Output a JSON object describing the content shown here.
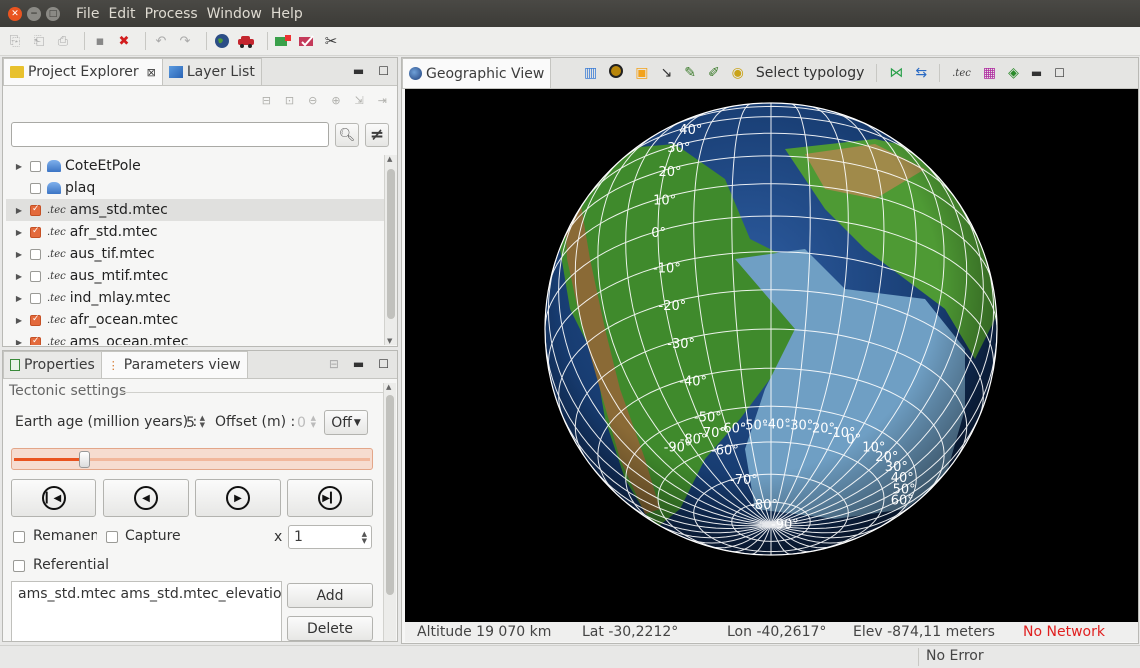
{
  "window": {
    "menu": [
      "File",
      "Edit",
      "Process",
      "Window",
      "Help"
    ]
  },
  "left_top": {
    "tabs": [
      {
        "label": "Project Explorer"
      },
      {
        "label": "Layer List"
      }
    ],
    "search_value": "",
    "tree": [
      {
        "label": "CoteEtPole",
        "checked": false,
        "icon": "cloud-layer-icon",
        "expand": true
      },
      {
        "label": "plaq",
        "checked": false,
        "icon": "cloud-layer-icon",
        "expand": false
      },
      {
        "label": "ams_std.mtec",
        "checked": true,
        "icon": "tec-file-icon",
        "expand": true,
        "selected": true
      },
      {
        "label": "afr_std.mtec",
        "checked": true,
        "icon": "tec-file-icon",
        "expand": true
      },
      {
        "label": "aus_tif.mtec",
        "checked": false,
        "icon": "tec-file-icon",
        "expand": true
      },
      {
        "label": "aus_mtif.mtec",
        "checked": false,
        "icon": "tec-file-icon",
        "expand": true
      },
      {
        "label": "ind_mlay.mtec",
        "checked": false,
        "icon": "tec-file-icon",
        "expand": true
      },
      {
        "label": "afr_ocean.mtec",
        "checked": true,
        "icon": "tec-file-icon",
        "expand": true
      },
      {
        "label": "ams_ocean.mtec",
        "checked": true,
        "icon": "tec-file-icon",
        "expand": true
      }
    ],
    "tec_icon_text": ".tec"
  },
  "left_bottom": {
    "tabs": [
      {
        "label": "Properties"
      },
      {
        "label": "Parameters view"
      }
    ],
    "group_title": "Tectonic settings",
    "earth_age_label": "Earth age (million years) :",
    "earth_age_value": "5",
    "offset_label": "Offset (m) :",
    "offset_value": "0",
    "offset_mode": "Off",
    "slider_fraction": 0.2,
    "remanent_label": "Remanent",
    "capture_label": "Capture",
    "multiplier_label": "x",
    "multiplier_value": "1",
    "referential_label": "Referential",
    "list_text": "ams_std.mtec ams_std.mtec_elevation ar",
    "add_label": "Add",
    "delete_label": "Delete"
  },
  "right": {
    "tab_label": "Geographic View",
    "select_typology_label": "Select typology",
    "tec_text": ".tec",
    "lat_labels": [
      "40°",
      "30°",
      "20°",
      "10°",
      "0°",
      "-10°",
      "-20°",
      "-30°",
      "-40°",
      "-50°",
      "-60°",
      "-70°",
      "-80°",
      "-90°"
    ],
    "lon_labels": [
      "-90°",
      "-80°",
      "-70°",
      "-60°",
      "-50°",
      "-40°",
      "-30°",
      "-20°",
      "-10°",
      "0°",
      "10°",
      "20°",
      "30°",
      "40°",
      "50°",
      "60°"
    ],
    "status": {
      "altitude": "Altitude  19 070 km",
      "lat": "Lat -30,2212°",
      "lon": "Lon -40,2617°",
      "elev": "Elev -874,11 meters",
      "network": "No Network"
    }
  },
  "statusbar": {
    "error_text": "No Error"
  },
  "colors": {
    "accent": "#e95420",
    "network_error": "#e02020",
    "checked": "#e36a3c"
  }
}
